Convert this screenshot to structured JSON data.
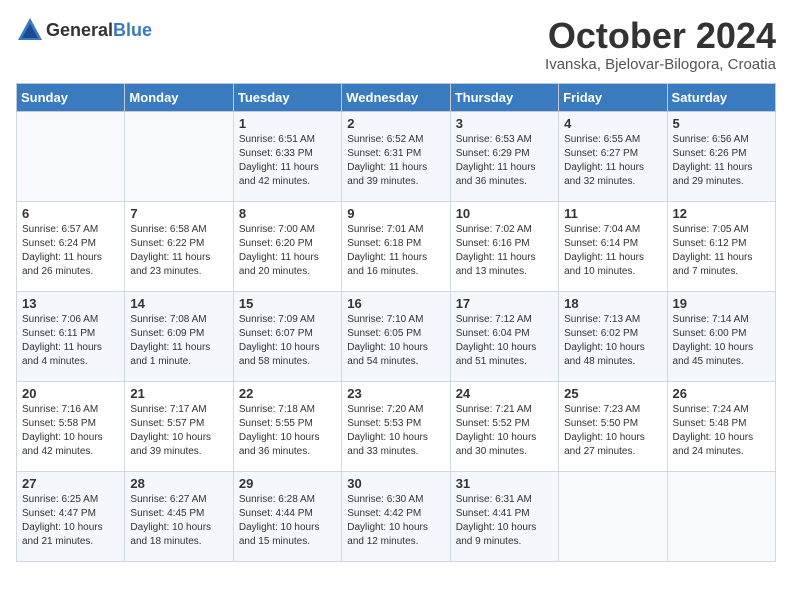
{
  "header": {
    "logo_general": "General",
    "logo_blue": "Blue",
    "month": "October 2024",
    "location": "Ivanska, Bjelovar-Bilogora, Croatia"
  },
  "days_of_week": [
    "Sunday",
    "Monday",
    "Tuesday",
    "Wednesday",
    "Thursday",
    "Friday",
    "Saturday"
  ],
  "weeks": [
    [
      {
        "day": "",
        "info": ""
      },
      {
        "day": "",
        "info": ""
      },
      {
        "day": "1",
        "info": "Sunrise: 6:51 AM\nSunset: 6:33 PM\nDaylight: 11 hours and 42 minutes."
      },
      {
        "day": "2",
        "info": "Sunrise: 6:52 AM\nSunset: 6:31 PM\nDaylight: 11 hours and 39 minutes."
      },
      {
        "day": "3",
        "info": "Sunrise: 6:53 AM\nSunset: 6:29 PM\nDaylight: 11 hours and 36 minutes."
      },
      {
        "day": "4",
        "info": "Sunrise: 6:55 AM\nSunset: 6:27 PM\nDaylight: 11 hours and 32 minutes."
      },
      {
        "day": "5",
        "info": "Sunrise: 6:56 AM\nSunset: 6:26 PM\nDaylight: 11 hours and 29 minutes."
      }
    ],
    [
      {
        "day": "6",
        "info": "Sunrise: 6:57 AM\nSunset: 6:24 PM\nDaylight: 11 hours and 26 minutes."
      },
      {
        "day": "7",
        "info": "Sunrise: 6:58 AM\nSunset: 6:22 PM\nDaylight: 11 hours and 23 minutes."
      },
      {
        "day": "8",
        "info": "Sunrise: 7:00 AM\nSunset: 6:20 PM\nDaylight: 11 hours and 20 minutes."
      },
      {
        "day": "9",
        "info": "Sunrise: 7:01 AM\nSunset: 6:18 PM\nDaylight: 11 hours and 16 minutes."
      },
      {
        "day": "10",
        "info": "Sunrise: 7:02 AM\nSunset: 6:16 PM\nDaylight: 11 hours and 13 minutes."
      },
      {
        "day": "11",
        "info": "Sunrise: 7:04 AM\nSunset: 6:14 PM\nDaylight: 11 hours and 10 minutes."
      },
      {
        "day": "12",
        "info": "Sunrise: 7:05 AM\nSunset: 6:12 PM\nDaylight: 11 hours and 7 minutes."
      }
    ],
    [
      {
        "day": "13",
        "info": "Sunrise: 7:06 AM\nSunset: 6:11 PM\nDaylight: 11 hours and 4 minutes."
      },
      {
        "day": "14",
        "info": "Sunrise: 7:08 AM\nSunset: 6:09 PM\nDaylight: 11 hours and 1 minute."
      },
      {
        "day": "15",
        "info": "Sunrise: 7:09 AM\nSunset: 6:07 PM\nDaylight: 10 hours and 58 minutes."
      },
      {
        "day": "16",
        "info": "Sunrise: 7:10 AM\nSunset: 6:05 PM\nDaylight: 10 hours and 54 minutes."
      },
      {
        "day": "17",
        "info": "Sunrise: 7:12 AM\nSunset: 6:04 PM\nDaylight: 10 hours and 51 minutes."
      },
      {
        "day": "18",
        "info": "Sunrise: 7:13 AM\nSunset: 6:02 PM\nDaylight: 10 hours and 48 minutes."
      },
      {
        "day": "19",
        "info": "Sunrise: 7:14 AM\nSunset: 6:00 PM\nDaylight: 10 hours and 45 minutes."
      }
    ],
    [
      {
        "day": "20",
        "info": "Sunrise: 7:16 AM\nSunset: 5:58 PM\nDaylight: 10 hours and 42 minutes."
      },
      {
        "day": "21",
        "info": "Sunrise: 7:17 AM\nSunset: 5:57 PM\nDaylight: 10 hours and 39 minutes."
      },
      {
        "day": "22",
        "info": "Sunrise: 7:18 AM\nSunset: 5:55 PM\nDaylight: 10 hours and 36 minutes."
      },
      {
        "day": "23",
        "info": "Sunrise: 7:20 AM\nSunset: 5:53 PM\nDaylight: 10 hours and 33 minutes."
      },
      {
        "day": "24",
        "info": "Sunrise: 7:21 AM\nSunset: 5:52 PM\nDaylight: 10 hours and 30 minutes."
      },
      {
        "day": "25",
        "info": "Sunrise: 7:23 AM\nSunset: 5:50 PM\nDaylight: 10 hours and 27 minutes."
      },
      {
        "day": "26",
        "info": "Sunrise: 7:24 AM\nSunset: 5:48 PM\nDaylight: 10 hours and 24 minutes."
      }
    ],
    [
      {
        "day": "27",
        "info": "Sunrise: 6:25 AM\nSunset: 4:47 PM\nDaylight: 10 hours and 21 minutes."
      },
      {
        "day": "28",
        "info": "Sunrise: 6:27 AM\nSunset: 4:45 PM\nDaylight: 10 hours and 18 minutes."
      },
      {
        "day": "29",
        "info": "Sunrise: 6:28 AM\nSunset: 4:44 PM\nDaylight: 10 hours and 15 minutes."
      },
      {
        "day": "30",
        "info": "Sunrise: 6:30 AM\nSunset: 4:42 PM\nDaylight: 10 hours and 12 minutes."
      },
      {
        "day": "31",
        "info": "Sunrise: 6:31 AM\nSunset: 4:41 PM\nDaylight: 10 hours and 9 minutes."
      },
      {
        "day": "",
        "info": ""
      },
      {
        "day": "",
        "info": ""
      }
    ]
  ]
}
